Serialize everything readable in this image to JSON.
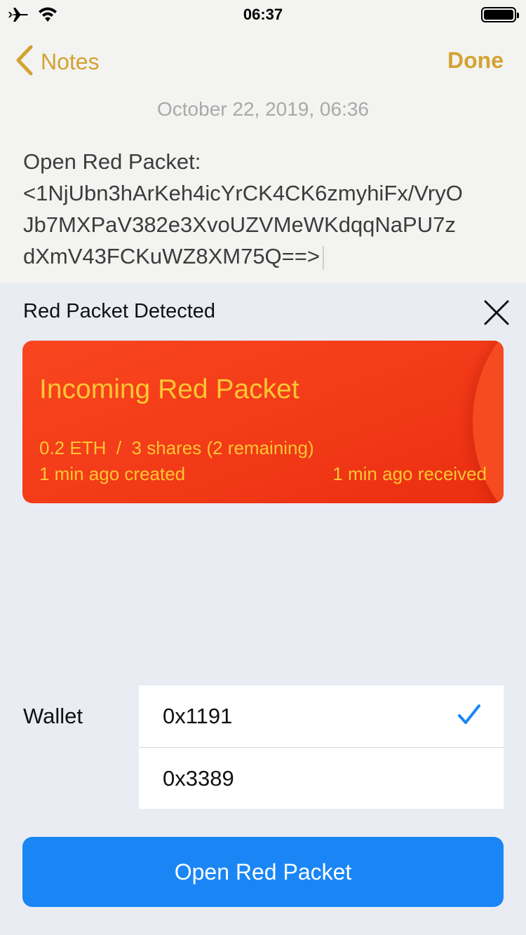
{
  "status_bar": {
    "time": "06:37",
    "icons": [
      "airplane-icon",
      "wifi-icon",
      "battery-icon"
    ]
  },
  "nav": {
    "back_label": "Notes",
    "done_label": "Done",
    "accent_color": "#d3a332"
  },
  "note": {
    "date": "October 22, 2019, 06:36",
    "lines": [
      "Open Red Packet:",
      "<1NjUbn3hArKeh4icYrCK4CK6zmyhiFx/VryO",
      "Jb7MXPaV382e3XvoUZVMeWKdqqNaPU7z",
      "dXmV43FCKuWZ8XM75Q==>"
    ]
  },
  "sheet": {
    "title": "Red Packet Detected",
    "close_icon": "close-icon"
  },
  "packet": {
    "title": "Incoming Red Packet",
    "amount": "0.2 ETH",
    "separator": "/",
    "shares": "3 shares (2 remaining)",
    "created": "1 min ago created",
    "received": "1 min ago received",
    "card_color": "#f23a18",
    "text_color": "#fdc632"
  },
  "wallet": {
    "label": "Wallet",
    "options": [
      {
        "address": "0x1191",
        "selected": true
      },
      {
        "address": "0x3389",
        "selected": false
      }
    ]
  },
  "actions": {
    "open_label": "Open Red Packet",
    "button_color": "#1a86f6"
  }
}
